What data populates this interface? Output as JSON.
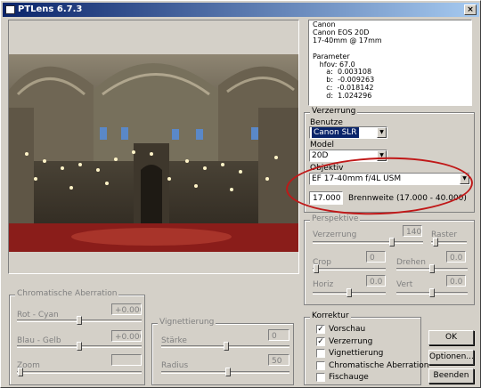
{
  "window": {
    "title": "PTLens 6.7.3",
    "close_glyph": "×"
  },
  "info": {
    "lines": [
      "Canon",
      "Canon EOS 20D",
      "17-40mm @ 17mm",
      "",
      "Parameter",
      "   hfov: 67.0",
      "      a:  0.003108",
      "      b:  -0.009263",
      "      c:  -0.018142",
      "      d:  1.024296"
    ]
  },
  "verzerrung": {
    "group_label": "Verzerrung",
    "benutze_label": "Benutze",
    "benutze_value": "Canon SLR",
    "model_label": "Model",
    "model_value": "20D",
    "objektiv_label": "Objektiv",
    "objektiv_value": "EF 17-40mm f/4L USM",
    "brennweite_value": "17.000",
    "brennweite_label": "Brennweite (17.000 - 40.000)"
  },
  "perspektive": {
    "group_label": "Perspektive",
    "verzerrung_label": "Verzerrung",
    "verzerrung_value": "140",
    "raster_label": "Raster",
    "crop_label": "Crop",
    "crop_value": "0",
    "drehen_label": "Drehen",
    "drehen_value": "0.0",
    "horiz_label": "Horiz",
    "horiz_value": "0.0",
    "vert_label": "Vert",
    "vert_value": "0.0"
  },
  "chromatic": {
    "group_label": "Chromatische Aberration",
    "rot_label": "Rot - Cyan",
    "rot_value": "+0.0000",
    "blau_label": "Blau - Gelb",
    "blau_value": "+0.0000",
    "zoom_label": "Zoom",
    "zoom_value": ""
  },
  "vignettierung": {
    "group_label": "Vignettierung",
    "starke_label": "Stärke",
    "starke_value": "0",
    "radius_label": "Radius",
    "radius_value": "50"
  },
  "korrektur": {
    "group_label": "Korrektur",
    "items": [
      {
        "label": "Vorschau",
        "checked": true
      },
      {
        "label": "Verzerrung",
        "checked": true
      },
      {
        "label": "Vignettierung",
        "checked": false
      },
      {
        "label": "Chromatische Aberration",
        "checked": false
      },
      {
        "label": "Fischauge",
        "checked": false
      }
    ]
  },
  "buttons": {
    "ok": "OK",
    "optionen": "Optionen...",
    "beenden": "Beenden"
  },
  "colors": {
    "titlebar": "#0a246a",
    "highlight_ellipse": "#c01818",
    "carpet": "#8a1d1a"
  }
}
